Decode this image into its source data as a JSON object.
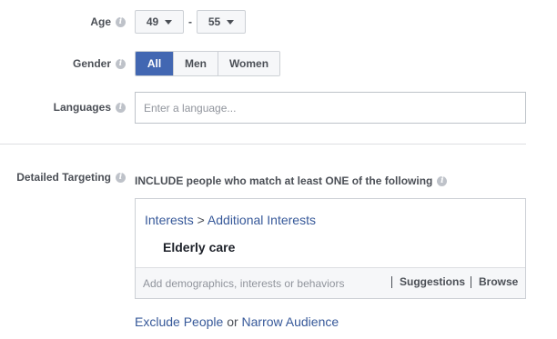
{
  "age": {
    "label": "Age",
    "min": "49",
    "separator": "-",
    "max": "55"
  },
  "gender": {
    "label": "Gender",
    "options": [
      "All",
      "Men",
      "Women"
    ],
    "selected": "All"
  },
  "languages": {
    "label": "Languages",
    "placeholder": "Enter a language..."
  },
  "detailed_targeting": {
    "label": "Detailed Targeting",
    "include_text": "INCLUDE people who match at least ONE of the following",
    "breadcrumb": {
      "root": "Interests",
      "separator": ">",
      "child": "Additional Interests"
    },
    "selected_item": "Elderly care",
    "search_placeholder": "Add demographics, interests or behaviors",
    "suggestions_label": "Suggestions",
    "browse_label": "Browse"
  },
  "footer": {
    "exclude_link": "Exclude People",
    "or_text": "or",
    "narrow_link": "Narrow Audience"
  },
  "colors": {
    "accent": "#4267b2",
    "link": "#365899"
  },
  "icons": {
    "info": "info-icon",
    "caret": "chevron-down-icon"
  }
}
